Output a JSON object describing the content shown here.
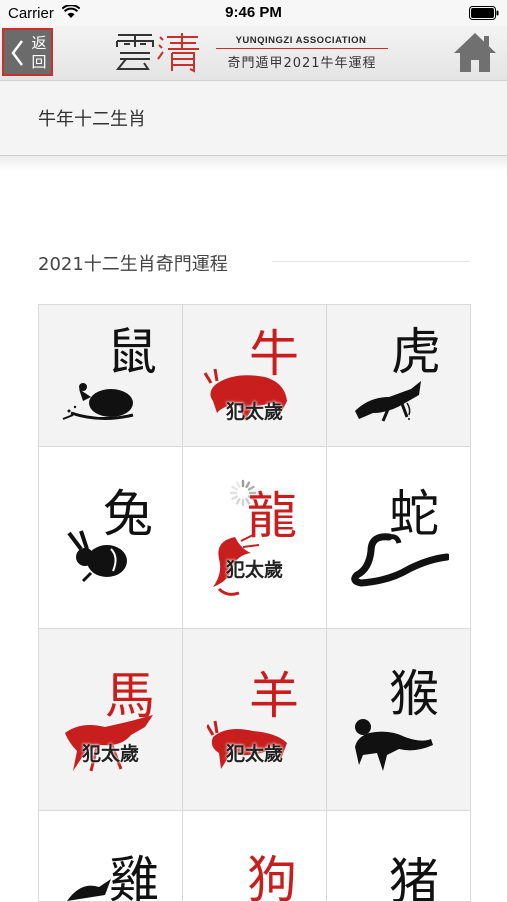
{
  "status_bar": {
    "carrier": "Carrier",
    "time": "9:46 PM"
  },
  "nav": {
    "back_label": "返回",
    "back_line1": "返",
    "back_line2": "回",
    "logo_text": "雲清",
    "association": "YUNQINGZI ASSOCIATION",
    "subtitle": "奇門遁甲2021牛年運程"
  },
  "section": {
    "title": "牛年十二生肖"
  },
  "zodiac_section": {
    "heading": "2021十二生肖奇門運程",
    "tai_sui_label": "犯太歲",
    "items": [
      {
        "name": "鼠",
        "color": "#111111",
        "tai_sui": false
      },
      {
        "name": "牛",
        "color": "#c81e1e",
        "tai_sui": true
      },
      {
        "name": "虎",
        "color": "#111111",
        "tai_sui": false
      },
      {
        "name": "兔",
        "color": "#111111",
        "tai_sui": false
      },
      {
        "name": "龍",
        "color": "#c81e1e",
        "tai_sui": true
      },
      {
        "name": "蛇",
        "color": "#111111",
        "tai_sui": false
      },
      {
        "name": "馬",
        "color": "#c81e1e",
        "tai_sui": true
      },
      {
        "name": "羊",
        "color": "#c81e1e",
        "tai_sui": true
      },
      {
        "name": "猴",
        "color": "#111111",
        "tai_sui": false
      },
      {
        "name": "雞",
        "color": "#111111",
        "tai_sui": false
      },
      {
        "name": "狗",
        "color": "#c81e1e",
        "tai_sui": false
      },
      {
        "name": "猪",
        "color": "#111111",
        "tai_sui": false
      }
    ]
  },
  "colors": {
    "accent": "#c81e1e",
    "ink": "#111111"
  }
}
